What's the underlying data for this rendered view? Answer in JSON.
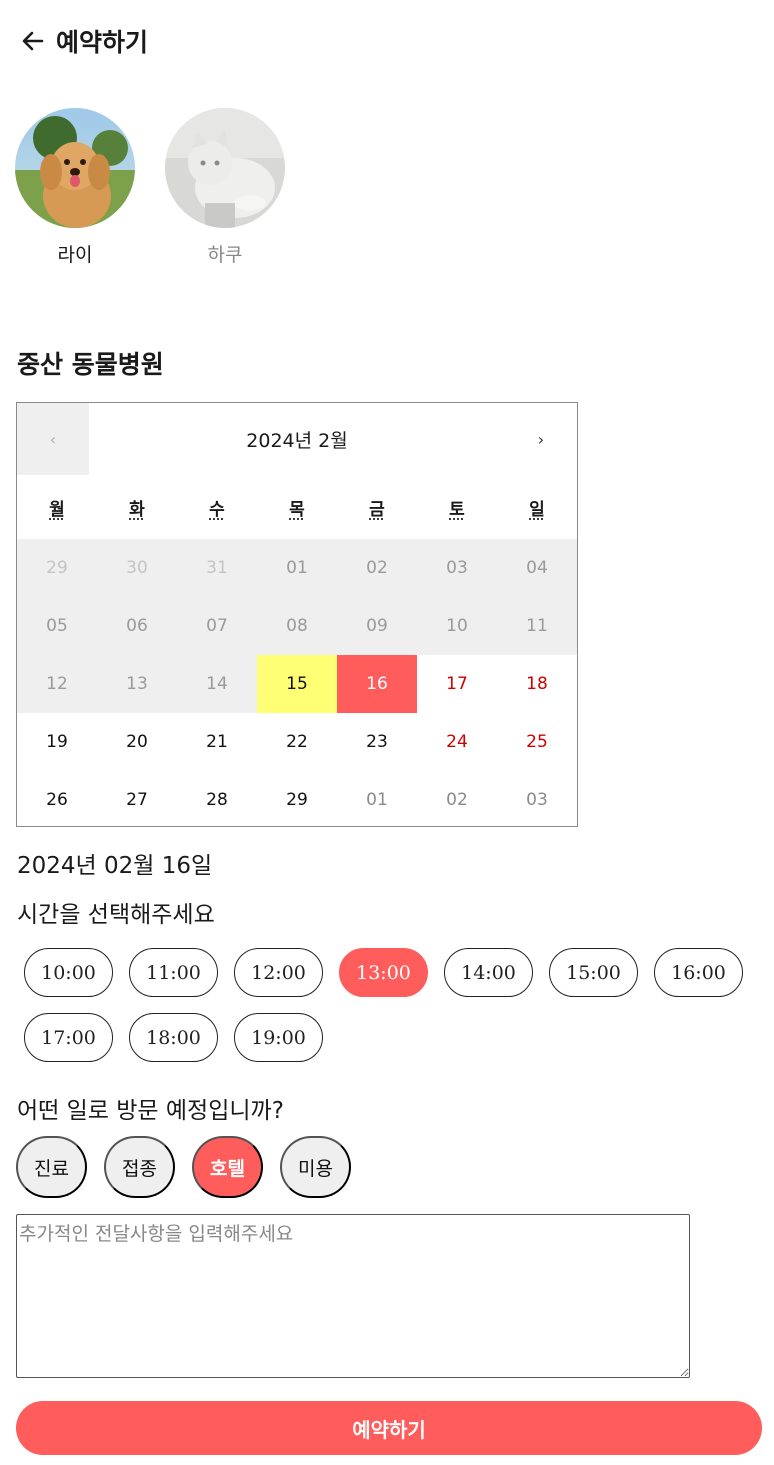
{
  "header": {
    "title": "예약하기",
    "back_icon": "arrow-left-icon"
  },
  "pets": [
    {
      "name": "라이",
      "selected": true
    },
    {
      "name": "하쿠",
      "selected": false
    }
  ],
  "hospital": {
    "name": "중산 동물병원"
  },
  "calendar": {
    "month_label": "2024년 2월",
    "prev_label": "‹",
    "next_label": "›",
    "weekdays": [
      "월",
      "화",
      "수",
      "목",
      "금",
      "토",
      "일"
    ],
    "weeks": [
      [
        "29",
        "30",
        "31",
        "01",
        "02",
        "03",
        "04"
      ],
      [
        "05",
        "06",
        "07",
        "08",
        "09",
        "10",
        "11"
      ],
      [
        "12",
        "13",
        "14",
        "15",
        "16",
        "17",
        "18"
      ],
      [
        "19",
        "20",
        "21",
        "22",
        "23",
        "24",
        "25"
      ],
      [
        "26",
        "27",
        "28",
        "29",
        "01",
        "02",
        "03"
      ]
    ],
    "today": "15",
    "selected_day": "16",
    "colors": {
      "today": "#ffff76",
      "selected": "#ff5c5c",
      "weekend": "#d10000",
      "disabled_bg": "#efefef"
    }
  },
  "selected_date_text": "2024년 02월 16일",
  "time_prompt": "시간을 선택해주세요",
  "times": [
    "10:00",
    "11:00",
    "12:00",
    "13:00",
    "14:00",
    "15:00",
    "16:00",
    "17:00",
    "18:00",
    "19:00"
  ],
  "selected_time": "13:00",
  "visit_prompt": "어떤 일로 방문 예정입니까?",
  "purposes": [
    "진료",
    "접종",
    "호텔",
    "미용"
  ],
  "selected_purpose": "호텔",
  "memo": {
    "placeholder": "추가적인 전달사항을 입력해주세요",
    "value": ""
  },
  "submit_label": "예약하기",
  "accent_color": "#ff5c5c"
}
